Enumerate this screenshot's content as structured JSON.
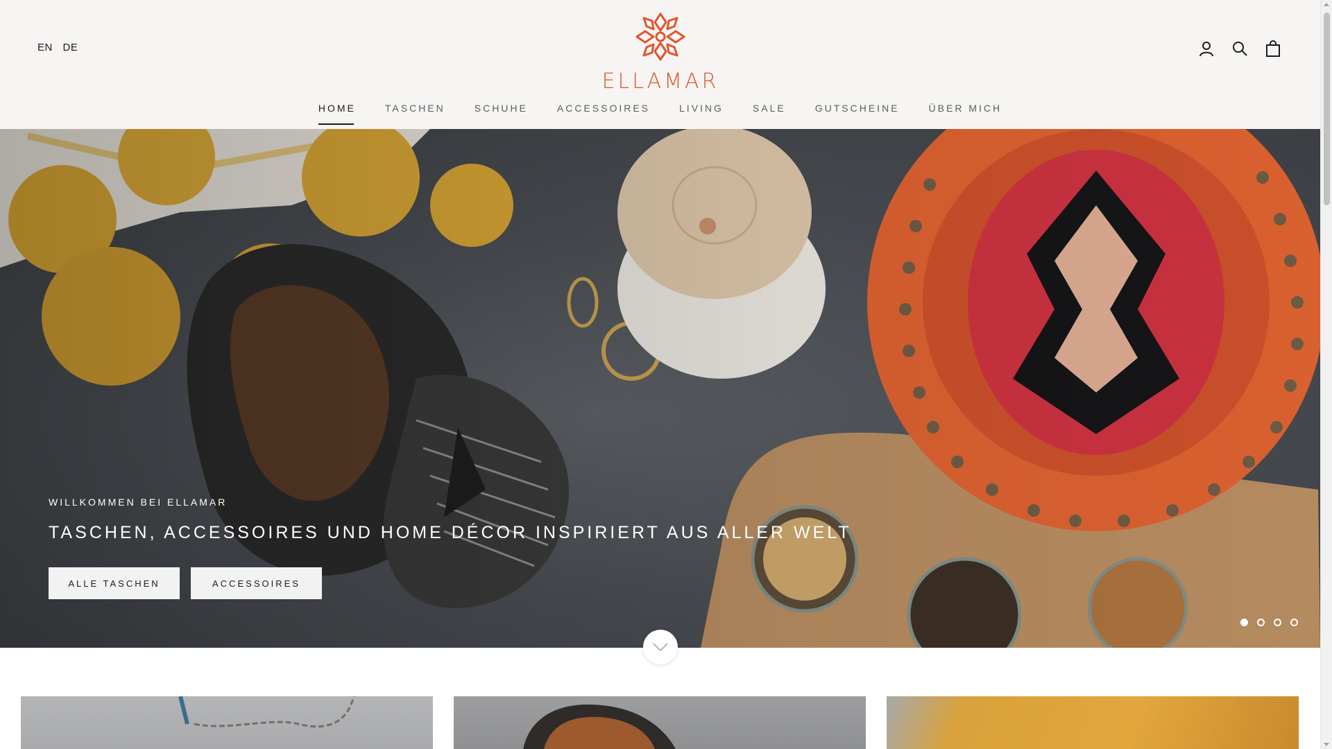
{
  "header": {
    "languages": [
      "EN",
      "DE"
    ],
    "logo_text": "ELLAMAR",
    "icons": [
      "account-icon",
      "search-icon",
      "cart-icon"
    ]
  },
  "nav": {
    "items": [
      {
        "label": "HOME",
        "active": true
      },
      {
        "label": "TASCHEN",
        "active": false
      },
      {
        "label": "SCHUHE",
        "active": false
      },
      {
        "label": "ACCESSOIRES",
        "active": false
      },
      {
        "label": "LIVING",
        "active": false
      },
      {
        "label": "SALE",
        "active": false
      },
      {
        "label": "GUTSCHEINE",
        "active": false
      },
      {
        "label": "ÜBER MICH",
        "active": false
      }
    ]
  },
  "hero": {
    "kicker": "WILLKOMMEN BEI ELLAMAR",
    "title": "TASCHEN, ACCESSOIRES UND HOME DÉCOR INSPIRIERT AUS ALLER WELT",
    "buttons": [
      "ALLE TASCHEN",
      "ACCESSOIRES"
    ],
    "slide_count": 4,
    "active_slide": 1
  },
  "colors": {
    "brand": "#e2542e",
    "header_bg": "#f6f5f3",
    "text": "#1c1b1b"
  }
}
